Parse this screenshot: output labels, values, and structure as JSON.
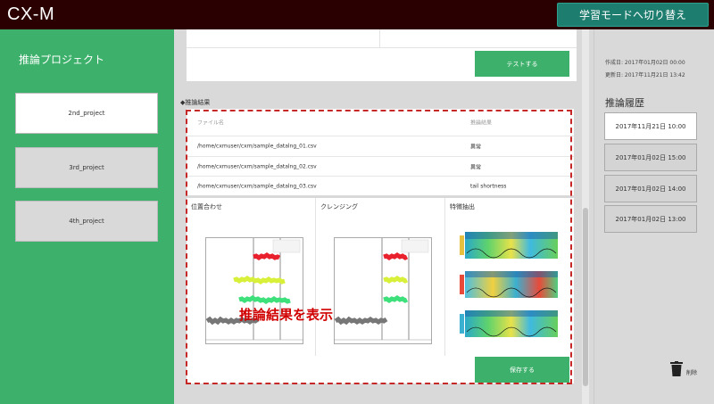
{
  "header": {
    "app_title": "CX-M",
    "mode_button": "学習モードへ切り替え"
  },
  "left_sidebar": {
    "title": "推論プロジェクト",
    "projects": [
      {
        "label": "2nd_project",
        "active": true
      },
      {
        "label": "3rd_project",
        "active": false
      },
      {
        "label": "4th_project",
        "active": false
      }
    ]
  },
  "main": {
    "test_button": "テストする",
    "section_label": "◆推論結果",
    "table": {
      "headers": [
        "ファイル名",
        "推論結果"
      ],
      "rows": [
        [
          "/home/cxmuser/cxm/sample_datalng_01.csv",
          "異常"
        ],
        [
          "/home/cxmuser/cxm/sample_datalng_02.csv",
          "異常"
        ],
        [
          "/home/cxmuser/cxm/sample_datalng_03.csv",
          "tail shortness"
        ]
      ]
    },
    "charts": [
      {
        "title": "位置合わせ"
      },
      {
        "title": "クレンジング"
      },
      {
        "title": "特徴抽出"
      }
    ],
    "overlay_text": "推論結果を表示",
    "save_button": "保存する"
  },
  "right_sidebar": {
    "created": "作成日: 2017年01月02日 00:00",
    "updated": "更新日: 2017年11月21日 13:42",
    "history_title": "推論履歴",
    "history": [
      {
        "label": "2017年11月21日 10:00",
        "active": true
      },
      {
        "label": "2017年01月02日 15:00",
        "active": false
      },
      {
        "label": "2017年01月02日 14:00",
        "active": false
      },
      {
        "label": "2017年01月02日 13:00",
        "active": false
      }
    ],
    "delete_label": "削除"
  },
  "colors": {
    "header_bg": "#2a0000",
    "sidebar_green": "#3db16b",
    "mode_button": "#1d7d6e",
    "annotation_red": "#d10000"
  }
}
